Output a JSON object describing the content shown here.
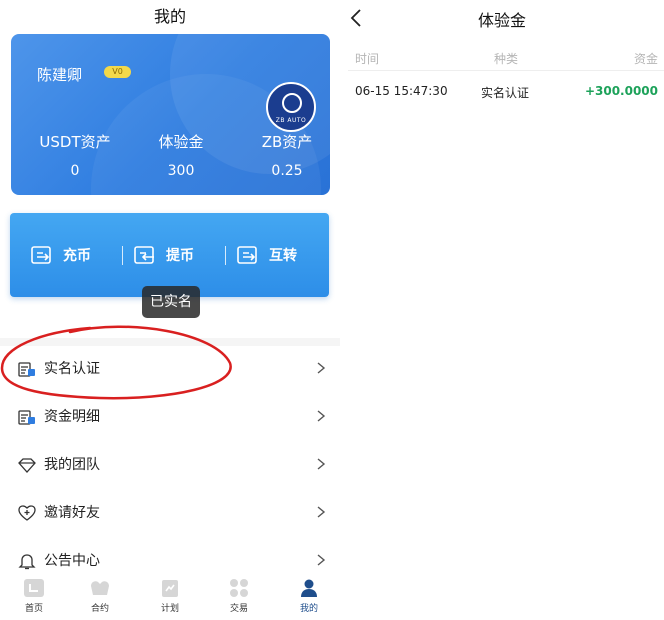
{
  "left": {
    "title": "我的",
    "profile": {
      "username": "陈建卿",
      "vip_level": "V0",
      "logo_text": "ZB AUTO",
      "stats": [
        {
          "label": "USDT资产",
          "value": "0"
        },
        {
          "label": "体验金",
          "value": "300"
        },
        {
          "label": "ZB资产",
          "value": "0.25"
        }
      ]
    },
    "actions": [
      {
        "label": "充币",
        "icon": "deposit-icon"
      },
      {
        "label": "提币",
        "icon": "withdraw-icon"
      },
      {
        "label": "互转",
        "icon": "transfer-icon"
      }
    ],
    "toast": "已实名",
    "menu": [
      {
        "label": "实名认证",
        "icon": "identity-verify-icon"
      },
      {
        "label": "资金明细",
        "icon": "fund-details-icon"
      },
      {
        "label": "我的团队",
        "icon": "team-icon"
      },
      {
        "label": "邀请好友",
        "icon": "invite-friends-icon"
      },
      {
        "label": "公告中心",
        "icon": "announcement-bell-icon"
      }
    ],
    "tabbar": [
      {
        "label": "首页",
        "icon": "home-icon"
      },
      {
        "label": "合约",
        "icon": "contract-icon"
      },
      {
        "label": "计划",
        "icon": "plan-icon"
      },
      {
        "label": "交易",
        "icon": "trade-icon"
      },
      {
        "label": "我的",
        "icon": "profile-icon",
        "active": true
      }
    ],
    "annotation_color": "#d92020"
  },
  "right": {
    "title": "体验金",
    "table": {
      "headers": [
        "时间",
        "种类",
        "资金"
      ],
      "rows": [
        {
          "time": "06-15 15:47:30",
          "type": "实名认证",
          "amount": "+300.0000"
        }
      ]
    },
    "amount_color": "#1da25a"
  },
  "colors": {
    "card_blue": "#2f7de0",
    "action_blue": "#2d8ee8",
    "vip_yellow": "#f3d94a",
    "tab_active": "#1f4e8c"
  }
}
